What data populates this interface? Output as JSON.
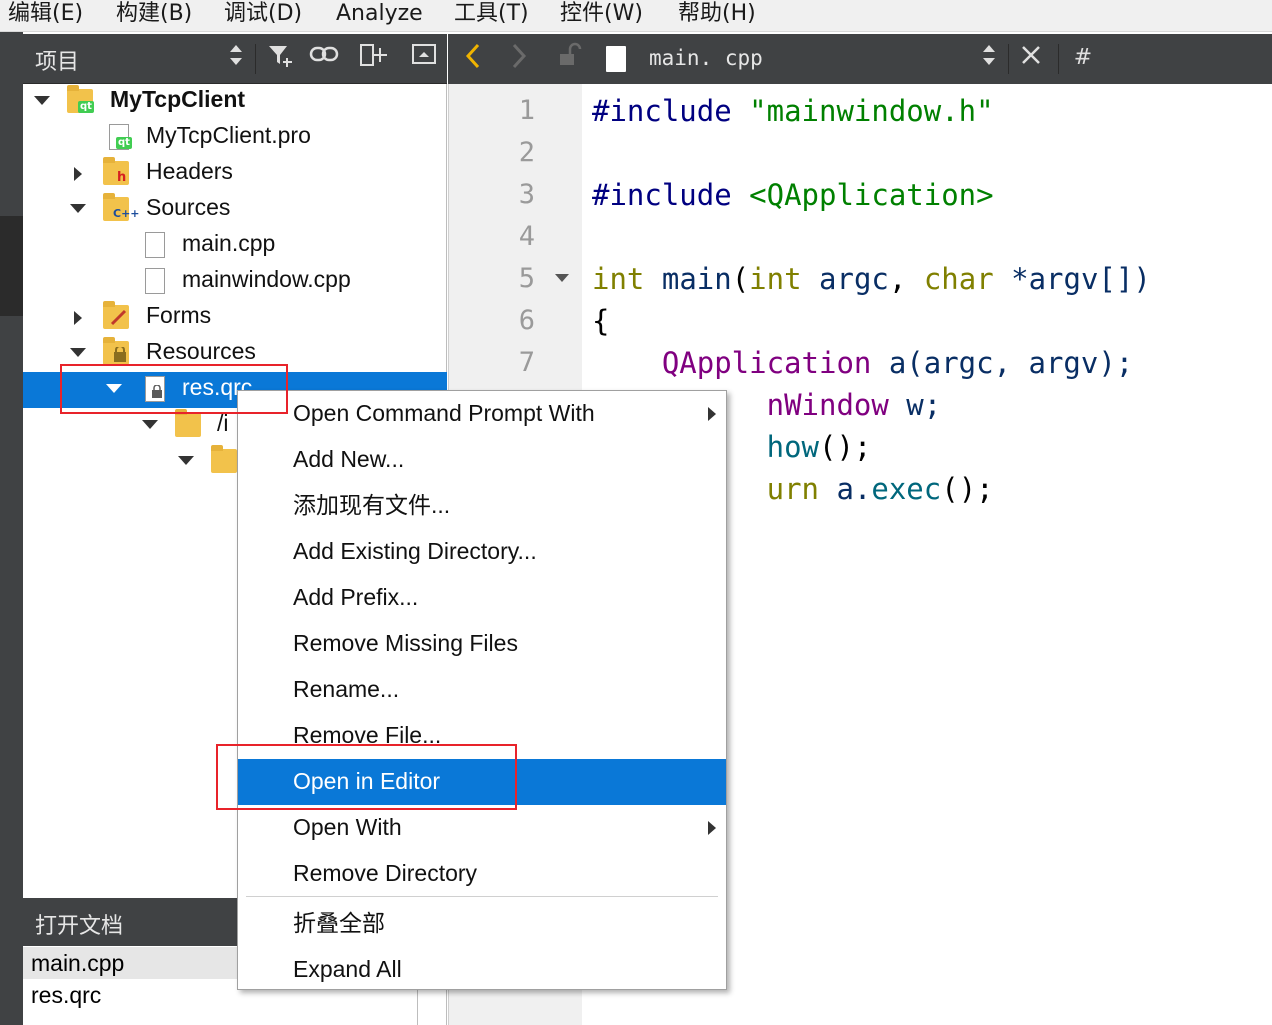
{
  "menubar": {
    "items": [
      "编辑(E)",
      "构建(B)",
      "调试(D)",
      "Analyze",
      "工具(T)",
      "控件(W)",
      "帮助(H)"
    ]
  },
  "project_panel": {
    "title": "项目",
    "toolbar_icons": [
      "sort-arrows-icon",
      "filter-icon",
      "link-icon",
      "split-add-icon",
      "hide-panel-icon"
    ]
  },
  "tree": {
    "project": "MyTcpClient",
    "pro_file": "MyTcpClient.pro",
    "headers": "Headers",
    "sources": "Sources",
    "main_cpp": "main.cpp",
    "mainwindow_cpp": "mainwindow.cpp",
    "forms": "Forms",
    "resources": "Resources",
    "res_qrc": "res.qrc",
    "prefix": "/i",
    "badges": {
      "qt": "qt",
      "h": "h",
      "cpp": "C++"
    }
  },
  "open_docs": {
    "title": "打开文档",
    "items": [
      "main.cpp",
      "res.qrc"
    ]
  },
  "editor": {
    "file_name": "main. cpp",
    "hash_symbol": "#",
    "line_numbers": [
      "1",
      "2",
      "3",
      "4",
      "5",
      "6",
      "7"
    ],
    "code": {
      "l1_directive": "#include",
      "l1_string": "\"mainwindow.h\"",
      "l3_directive": "#include",
      "l3_string": "<QApplication>",
      "l5_int": "int",
      "l5_main": "main",
      "l5_paren_open": "(",
      "l5_int2": "int",
      "l5_argc": "argc",
      "l5_comma": ",",
      "l5_char": "char",
      "l5_argv": "*argv[])",
      "l6": "{",
      "l7_class": "QApplication",
      "l7_rest": "a(argc, argv);",
      "l8_class": "nWindow",
      "l8_rest": "w;",
      "l9_fn": "how",
      "l9_rest": "();",
      "l10_kw": "urn",
      "l10_var": "a.",
      "l10_fn": "exec",
      "l10_rest": "();"
    }
  },
  "context_menu": {
    "items": [
      {
        "label": "Open Command Prompt With",
        "submenu": true
      },
      {
        "label": "Add New..."
      },
      {
        "label": "添加现有文件..."
      },
      {
        "label": "Add Existing Directory..."
      },
      {
        "label": "Add Prefix..."
      },
      {
        "label": "Remove Missing Files"
      },
      {
        "label": "Rename..."
      },
      {
        "label": "Remove File..."
      },
      {
        "label": "Open in Editor",
        "highlighted": true
      },
      {
        "label": "Open With",
        "submenu": true
      },
      {
        "label": "Remove Directory"
      },
      {
        "label": "折叠全部"
      },
      {
        "label": "Expand All"
      }
    ]
  },
  "colors": {
    "selection": "#0a78d7",
    "annotation_red": "#e8232a",
    "panel_dark": "#404244"
  }
}
